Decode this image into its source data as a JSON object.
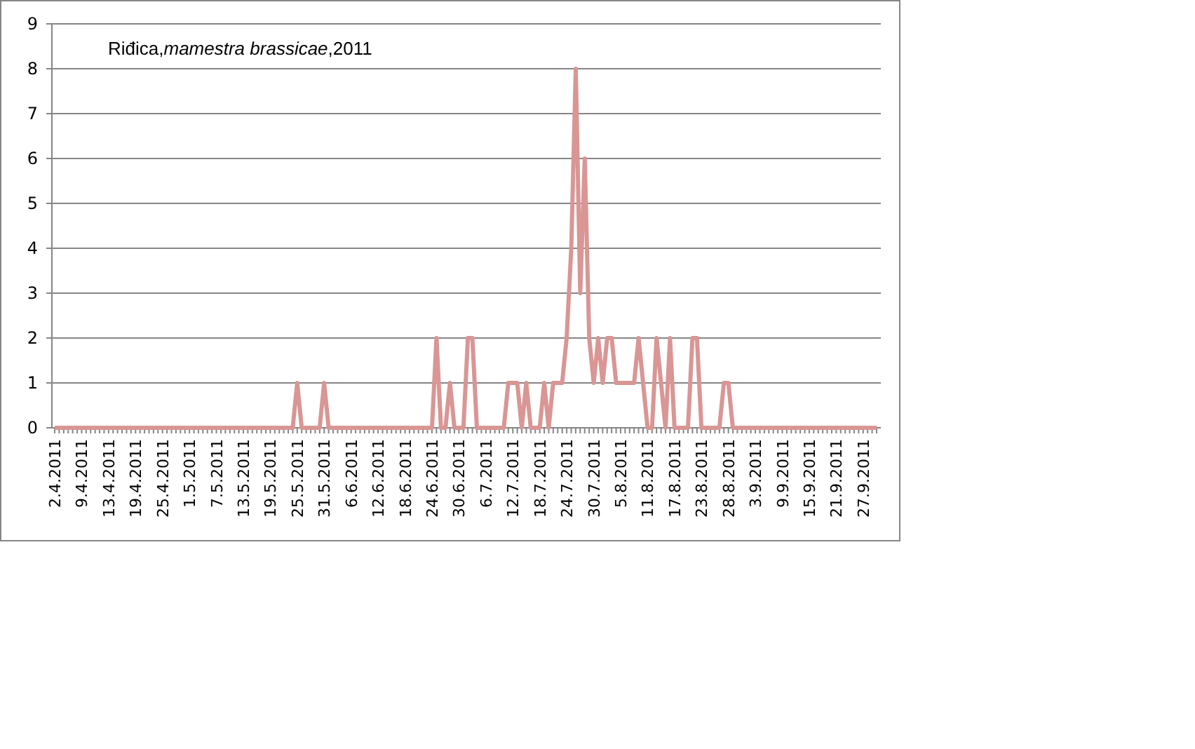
{
  "chart_data": {
    "type": "line",
    "title": "Riđica,*mamestra brassicae*,2011",
    "ylim": [
      0,
      9
    ],
    "yticks": [
      0,
      1,
      2,
      3,
      4,
      5,
      6,
      7,
      8,
      9
    ],
    "grid": true,
    "categories": [
      "2.4.2011",
      null,
      null,
      null,
      null,
      null,
      "9.4.2011",
      null,
      null,
      null,
      null,
      null,
      "13.4.2011",
      null,
      null,
      null,
      null,
      null,
      "19.4.2011",
      null,
      null,
      null,
      null,
      null,
      "25.4.2011",
      null,
      null,
      null,
      null,
      null,
      "1.5.2011",
      null,
      null,
      null,
      null,
      null,
      "7.5.2011",
      null,
      null,
      null,
      null,
      null,
      "13.5.2011",
      null,
      null,
      null,
      null,
      null,
      "19.5.2011",
      null,
      null,
      null,
      null,
      null,
      "25.5.2011",
      null,
      null,
      null,
      null,
      null,
      "31.5.2011",
      null,
      null,
      null,
      null,
      null,
      "6.6.2011",
      null,
      null,
      null,
      null,
      null,
      "12.6.2011",
      null,
      null,
      null,
      null,
      null,
      "18.6.2011",
      null,
      null,
      null,
      null,
      null,
      "24.6.2011",
      null,
      null,
      null,
      null,
      null,
      "30.6.2011",
      null,
      null,
      null,
      null,
      null,
      "6.7.2011",
      null,
      null,
      null,
      null,
      null,
      "12.7.2011",
      null,
      null,
      null,
      null,
      null,
      "18.7.2011",
      null,
      null,
      null,
      null,
      null,
      "24.7.2011",
      null,
      null,
      null,
      null,
      null,
      "30.7.2011",
      null,
      null,
      null,
      null,
      null,
      "5.8.2011",
      null,
      null,
      null,
      null,
      null,
      "11.8.2011",
      null,
      null,
      null,
      null,
      null,
      "17.8.2011",
      null,
      null,
      null,
      null,
      null,
      "23.8.2011",
      null,
      null,
      null,
      null,
      null,
      "28.8.2011",
      null,
      null,
      null,
      null,
      null,
      "3.9.2011",
      null,
      null,
      null,
      null,
      null,
      "9.9.2011",
      null,
      null,
      null,
      null,
      null,
      "15.9.2011",
      null,
      null,
      null,
      null,
      null,
      "21.9.2011",
      null,
      null,
      null,
      null,
      null,
      "27.9.2011",
      null,
      null,
      null
    ],
    "series": [
      {
        "color": "#d99694",
        "values": [
          0,
          0,
          0,
          0,
          0,
          0,
          0,
          0,
          0,
          0,
          0,
          0,
          0,
          0,
          0,
          0,
          0,
          0,
          0,
          0,
          0,
          0,
          0,
          0,
          0,
          0,
          0,
          0,
          0,
          0,
          0,
          0,
          0,
          0,
          0,
          0,
          0,
          0,
          0,
          0,
          0,
          0,
          0,
          0,
          0,
          0,
          0,
          0,
          0,
          0,
          0,
          0,
          0,
          0,
          1,
          0,
          0,
          0,
          0,
          0,
          1,
          0,
          0,
          0,
          0,
          0,
          0,
          0,
          0,
          0,
          0,
          0,
          0,
          0,
          0,
          0,
          0,
          0,
          0,
          0,
          0,
          0,
          0,
          0,
          0,
          2,
          0,
          0,
          1,
          0,
          0,
          0,
          2,
          2,
          0,
          0,
          0,
          0,
          0,
          0,
          0,
          1,
          1,
          1,
          0,
          1,
          0,
          0,
          0,
          1,
          0,
          1,
          1,
          1,
          2,
          4,
          8,
          3,
          6,
          2,
          1,
          2,
          1,
          2,
          2,
          1,
          1,
          1,
          1,
          1,
          2,
          1,
          0,
          0,
          2,
          1,
          0,
          2,
          0,
          0,
          0,
          0,
          2,
          2,
          0,
          0,
          0,
          0,
          0,
          1,
          1,
          0,
          0,
          0,
          0,
          0,
          0,
          0,
          0,
          0,
          0,
          0,
          0,
          0,
          0,
          0,
          0,
          0,
          0,
          0,
          0,
          0,
          0,
          0,
          0,
          0,
          0,
          0,
          0,
          0,
          0,
          0,
          0,
          0
        ]
      }
    ]
  }
}
